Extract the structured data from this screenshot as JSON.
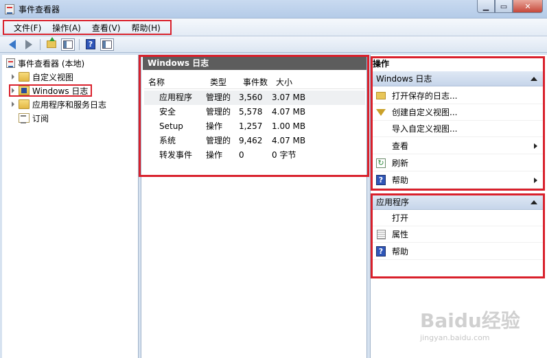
{
  "window": {
    "title": "事件查看器"
  },
  "menu": [
    "文件(F)",
    "操作(A)",
    "查看(V)",
    "帮助(H)"
  ],
  "tree": {
    "root": "事件查看器 (本地)",
    "items": [
      "自定义视图",
      "Windows 日志",
      "应用程序和服务日志",
      "订阅"
    ]
  },
  "center": {
    "header": "Windows 日志",
    "columns": [
      "名称",
      "类型",
      "事件数",
      "大小"
    ],
    "rows": [
      [
        "应用程序",
        "管理的",
        "3,560",
        "3.07 MB"
      ],
      [
        "安全",
        "管理的",
        "5,578",
        "4.07 MB"
      ],
      [
        "Setup",
        "操作",
        "1,257",
        "1.00 MB"
      ],
      [
        "系统",
        "管理的",
        "9,462",
        "4.07 MB"
      ],
      [
        "转发事件",
        "操作",
        "0",
        "0 字节"
      ]
    ]
  },
  "actions": {
    "title": "操作",
    "section1": {
      "header": "Windows 日志",
      "items": [
        "打开保存的日志...",
        "创建自定义视图...",
        "导入自定义视图...",
        "查看",
        "刷新",
        "帮助"
      ]
    },
    "section2": {
      "header": "应用程序",
      "items": [
        "打开",
        "属性",
        "帮助"
      ]
    }
  },
  "watermark": {
    "logo": "Baidu经验",
    "url": "jingyan.baidu.com"
  },
  "colors": {
    "highlight": "#d9202b",
    "header_dark": "#5d5d5d"
  }
}
